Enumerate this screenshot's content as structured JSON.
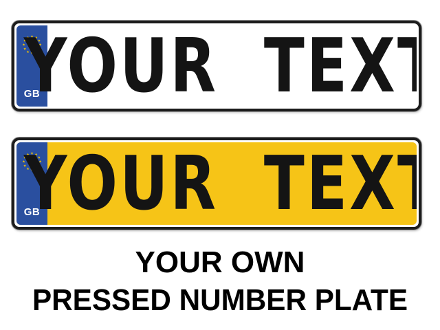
{
  "plates": [
    {
      "country_code": "GB",
      "text": "YOUR  TEXT",
      "background": "#ffffff",
      "band_color": "#2a4f9f"
    },
    {
      "country_code": "GB",
      "text": "YOUR  TEXT",
      "background": "#f6c417",
      "band_color": "#2a4f9f"
    }
  ],
  "caption": {
    "line1": "YOUR OWN",
    "line2": "PRESSED NUMBER PLATE"
  },
  "colors": {
    "stars": "#f2c200",
    "text": "#141414"
  },
  "icons": {
    "eu_flag": "eu-stars-icon"
  }
}
